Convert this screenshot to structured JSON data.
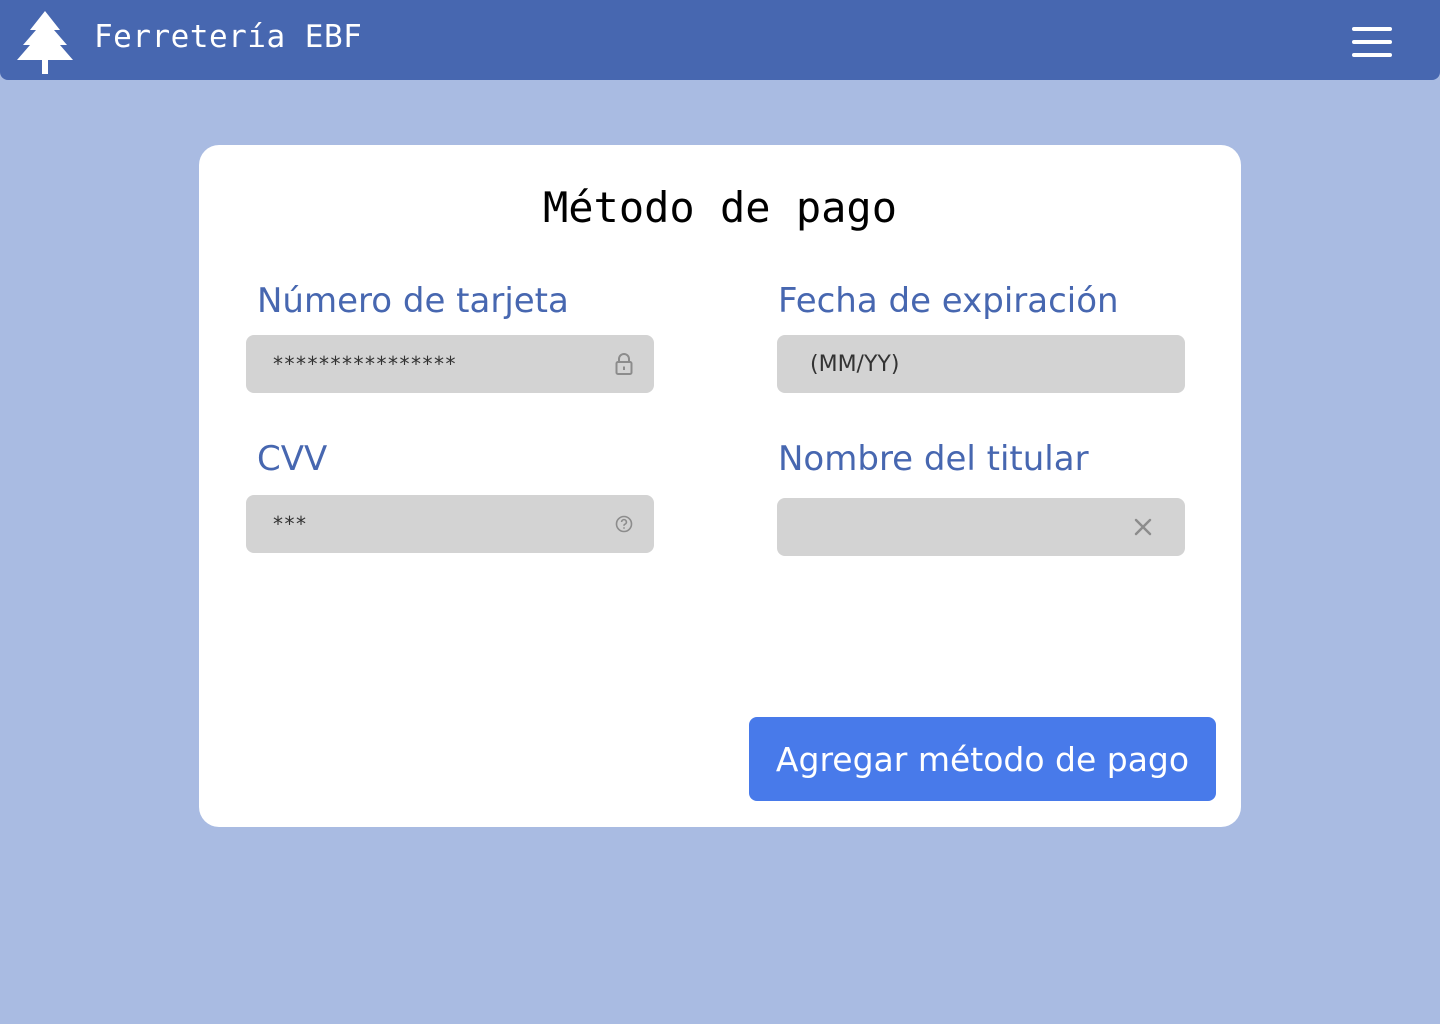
{
  "header": {
    "logo_icon": "pine-tree-icon",
    "brand_name": "Ferretería EBF",
    "menu_icon": "hamburger-menu-icon",
    "background_color": "#4767b0"
  },
  "form": {
    "title": "Método de pago",
    "card_number": {
      "label": "Número de tarjeta",
      "value": "****************",
      "icon": "lock-icon"
    },
    "expiration": {
      "label": "Fecha de expiración",
      "placeholder": "(MM/YY)",
      "value": ""
    },
    "cvv": {
      "label": "CVV",
      "value": "***",
      "icon": "help-circle-icon"
    },
    "holder_name": {
      "label": "Nombre del titular",
      "value": "",
      "icon": "clear-x-icon"
    },
    "submit_label": "Agregar método de pago"
  },
  "colors": {
    "page_background": "#a9bbe2",
    "label_color": "#4767b0",
    "input_background": "#d3d3d3",
    "button_background": "#487aea",
    "card_background": "#ffffff"
  }
}
